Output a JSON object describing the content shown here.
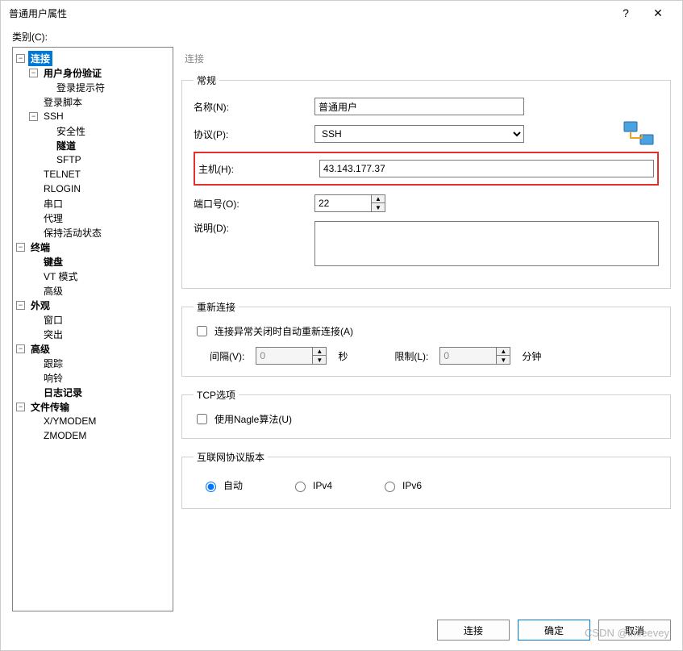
{
  "window": {
    "title": "普通用户属性",
    "help": "?",
    "close": "✕"
  },
  "category_label": "类别(C):",
  "tree": {
    "connection": {
      "label": "连接",
      "selected": true,
      "bold": true
    },
    "auth": {
      "label": "用户身份验证",
      "bold": true
    },
    "login_prompt": {
      "label": "登录提示符"
    },
    "login_script": {
      "label": "登录脚本"
    },
    "ssh": {
      "label": "SSH"
    },
    "security": {
      "label": "安全性"
    },
    "tunnel": {
      "label": "隧道",
      "bold": true
    },
    "sftp": {
      "label": "SFTP"
    },
    "telnet": {
      "label": "TELNET"
    },
    "rlogin": {
      "label": "RLOGIN"
    },
    "serial": {
      "label": "串口"
    },
    "proxy": {
      "label": "代理"
    },
    "keepalive": {
      "label": "保持活动状态"
    },
    "terminal": {
      "label": "终端",
      "bold": true
    },
    "keyboard": {
      "label": "键盘",
      "bold": true
    },
    "vtmode": {
      "label": "VT 模式"
    },
    "advanced_term": {
      "label": "高级"
    },
    "appearance": {
      "label": "外观",
      "bold": true
    },
    "window": {
      "label": "窗口"
    },
    "highlight": {
      "label": "突出"
    },
    "advanced": {
      "label": "高级",
      "bold": true
    },
    "trace": {
      "label": "跟踪"
    },
    "bell": {
      "label": "响铃"
    },
    "logging": {
      "label": "日志记录",
      "bold": true
    },
    "filetransfer": {
      "label": "文件传输",
      "bold": true
    },
    "xymodem": {
      "label": "X/YMODEM"
    },
    "zmodem": {
      "label": "ZMODEM"
    }
  },
  "panel": {
    "heading": "连接",
    "general": {
      "legend": "常规",
      "name_label": "名称(N):",
      "name_value": "普通用户",
      "protocol_label": "协议(P):",
      "protocol_value": "SSH",
      "host_label": "主机(H):",
      "host_value": "43.143.177.37",
      "port_label": "端口号(O):",
      "port_value": "22",
      "desc_label": "说明(D):",
      "desc_value": ""
    },
    "reconnect": {
      "legend": "重新连接",
      "checkbox": "连接异常关闭时自动重新连接(A)",
      "interval_label": "间隔(V):",
      "interval_value": "0",
      "interval_unit": "秒",
      "limit_label": "限制(L):",
      "limit_value": "0",
      "limit_unit": "分钟"
    },
    "tcp": {
      "legend": "TCP选项",
      "nagle": "使用Nagle算法(U)"
    },
    "ipver": {
      "legend": "互联网协议版本",
      "auto": "自动",
      "ipv4": "IPv4",
      "ipv6": "IPv6"
    }
  },
  "buttons": {
    "connect": "连接",
    "ok": "确定",
    "cancel": "取消"
  },
  "watermark": "CSDN @imleevey"
}
